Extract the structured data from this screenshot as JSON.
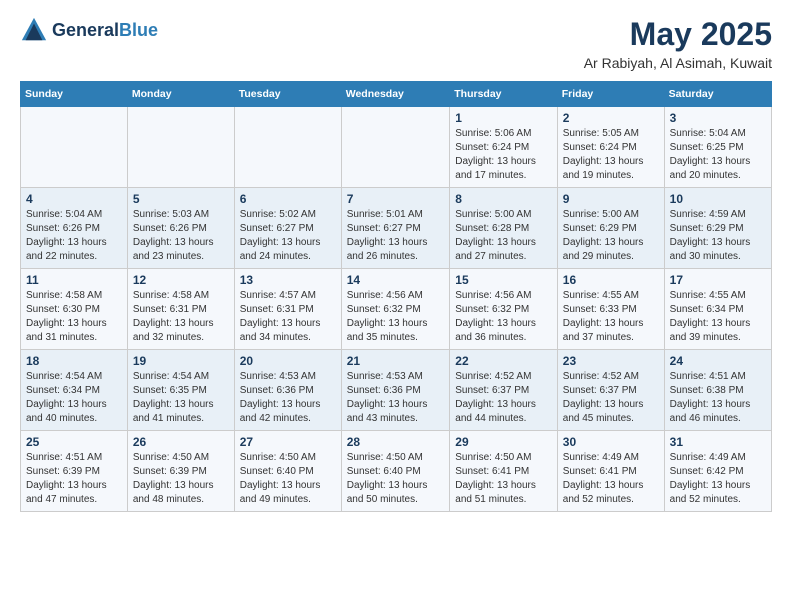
{
  "logo": {
    "text_general": "General",
    "text_blue": "Blue"
  },
  "header": {
    "month": "May 2025",
    "location": "Ar Rabiyah, Al Asimah, Kuwait"
  },
  "weekdays": [
    "Sunday",
    "Monday",
    "Tuesday",
    "Wednesday",
    "Thursday",
    "Friday",
    "Saturday"
  ],
  "weeks": [
    [
      {
        "day": "",
        "sunrise": "",
        "sunset": "",
        "daylight": ""
      },
      {
        "day": "",
        "sunrise": "",
        "sunset": "",
        "daylight": ""
      },
      {
        "day": "",
        "sunrise": "",
        "sunset": "",
        "daylight": ""
      },
      {
        "day": "",
        "sunrise": "",
        "sunset": "",
        "daylight": ""
      },
      {
        "day": "1",
        "sunrise": "Sunrise: 5:06 AM",
        "sunset": "Sunset: 6:24 PM",
        "daylight": "Daylight: 13 hours and 17 minutes."
      },
      {
        "day": "2",
        "sunrise": "Sunrise: 5:05 AM",
        "sunset": "Sunset: 6:24 PM",
        "daylight": "Daylight: 13 hours and 19 minutes."
      },
      {
        "day": "3",
        "sunrise": "Sunrise: 5:04 AM",
        "sunset": "Sunset: 6:25 PM",
        "daylight": "Daylight: 13 hours and 20 minutes."
      }
    ],
    [
      {
        "day": "4",
        "sunrise": "Sunrise: 5:04 AM",
        "sunset": "Sunset: 6:26 PM",
        "daylight": "Daylight: 13 hours and 22 minutes."
      },
      {
        "day": "5",
        "sunrise": "Sunrise: 5:03 AM",
        "sunset": "Sunset: 6:26 PM",
        "daylight": "Daylight: 13 hours and 23 minutes."
      },
      {
        "day": "6",
        "sunrise": "Sunrise: 5:02 AM",
        "sunset": "Sunset: 6:27 PM",
        "daylight": "Daylight: 13 hours and 24 minutes."
      },
      {
        "day": "7",
        "sunrise": "Sunrise: 5:01 AM",
        "sunset": "Sunset: 6:27 PM",
        "daylight": "Daylight: 13 hours and 26 minutes."
      },
      {
        "day": "8",
        "sunrise": "Sunrise: 5:00 AM",
        "sunset": "Sunset: 6:28 PM",
        "daylight": "Daylight: 13 hours and 27 minutes."
      },
      {
        "day": "9",
        "sunrise": "Sunrise: 5:00 AM",
        "sunset": "Sunset: 6:29 PM",
        "daylight": "Daylight: 13 hours and 29 minutes."
      },
      {
        "day": "10",
        "sunrise": "Sunrise: 4:59 AM",
        "sunset": "Sunset: 6:29 PM",
        "daylight": "Daylight: 13 hours and 30 minutes."
      }
    ],
    [
      {
        "day": "11",
        "sunrise": "Sunrise: 4:58 AM",
        "sunset": "Sunset: 6:30 PM",
        "daylight": "Daylight: 13 hours and 31 minutes."
      },
      {
        "day": "12",
        "sunrise": "Sunrise: 4:58 AM",
        "sunset": "Sunset: 6:31 PM",
        "daylight": "Daylight: 13 hours and 32 minutes."
      },
      {
        "day": "13",
        "sunrise": "Sunrise: 4:57 AM",
        "sunset": "Sunset: 6:31 PM",
        "daylight": "Daylight: 13 hours and 34 minutes."
      },
      {
        "day": "14",
        "sunrise": "Sunrise: 4:56 AM",
        "sunset": "Sunset: 6:32 PM",
        "daylight": "Daylight: 13 hours and 35 minutes."
      },
      {
        "day": "15",
        "sunrise": "Sunrise: 4:56 AM",
        "sunset": "Sunset: 6:32 PM",
        "daylight": "Daylight: 13 hours and 36 minutes."
      },
      {
        "day": "16",
        "sunrise": "Sunrise: 4:55 AM",
        "sunset": "Sunset: 6:33 PM",
        "daylight": "Daylight: 13 hours and 37 minutes."
      },
      {
        "day": "17",
        "sunrise": "Sunrise: 4:55 AM",
        "sunset": "Sunset: 6:34 PM",
        "daylight": "Daylight: 13 hours and 39 minutes."
      }
    ],
    [
      {
        "day": "18",
        "sunrise": "Sunrise: 4:54 AM",
        "sunset": "Sunset: 6:34 PM",
        "daylight": "Daylight: 13 hours and 40 minutes."
      },
      {
        "day": "19",
        "sunrise": "Sunrise: 4:54 AM",
        "sunset": "Sunset: 6:35 PM",
        "daylight": "Daylight: 13 hours and 41 minutes."
      },
      {
        "day": "20",
        "sunrise": "Sunrise: 4:53 AM",
        "sunset": "Sunset: 6:36 PM",
        "daylight": "Daylight: 13 hours and 42 minutes."
      },
      {
        "day": "21",
        "sunrise": "Sunrise: 4:53 AM",
        "sunset": "Sunset: 6:36 PM",
        "daylight": "Daylight: 13 hours and 43 minutes."
      },
      {
        "day": "22",
        "sunrise": "Sunrise: 4:52 AM",
        "sunset": "Sunset: 6:37 PM",
        "daylight": "Daylight: 13 hours and 44 minutes."
      },
      {
        "day": "23",
        "sunrise": "Sunrise: 4:52 AM",
        "sunset": "Sunset: 6:37 PM",
        "daylight": "Daylight: 13 hours and 45 minutes."
      },
      {
        "day": "24",
        "sunrise": "Sunrise: 4:51 AM",
        "sunset": "Sunset: 6:38 PM",
        "daylight": "Daylight: 13 hours and 46 minutes."
      }
    ],
    [
      {
        "day": "25",
        "sunrise": "Sunrise: 4:51 AM",
        "sunset": "Sunset: 6:39 PM",
        "daylight": "Daylight: 13 hours and 47 minutes."
      },
      {
        "day": "26",
        "sunrise": "Sunrise: 4:50 AM",
        "sunset": "Sunset: 6:39 PM",
        "daylight": "Daylight: 13 hours and 48 minutes."
      },
      {
        "day": "27",
        "sunrise": "Sunrise: 4:50 AM",
        "sunset": "Sunset: 6:40 PM",
        "daylight": "Daylight: 13 hours and 49 minutes."
      },
      {
        "day": "28",
        "sunrise": "Sunrise: 4:50 AM",
        "sunset": "Sunset: 6:40 PM",
        "daylight": "Daylight: 13 hours and 50 minutes."
      },
      {
        "day": "29",
        "sunrise": "Sunrise: 4:50 AM",
        "sunset": "Sunset: 6:41 PM",
        "daylight": "Daylight: 13 hours and 51 minutes."
      },
      {
        "day": "30",
        "sunrise": "Sunrise: 4:49 AM",
        "sunset": "Sunset: 6:41 PM",
        "daylight": "Daylight: 13 hours and 52 minutes."
      },
      {
        "day": "31",
        "sunrise": "Sunrise: 4:49 AM",
        "sunset": "Sunset: 6:42 PM",
        "daylight": "Daylight: 13 hours and 52 minutes."
      }
    ]
  ]
}
